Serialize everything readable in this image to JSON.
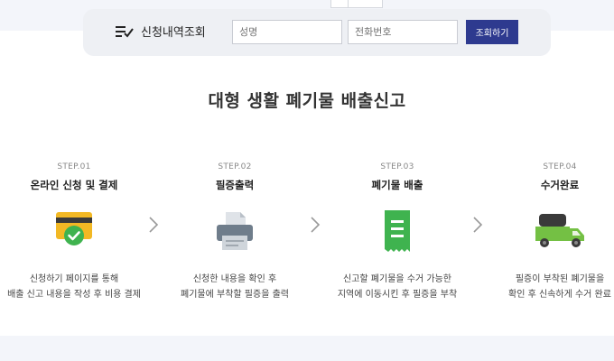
{
  "search": {
    "title": "신청내역조회",
    "name_placeholder": "성명",
    "phone_placeholder": "전화번호",
    "button_label": "조회하기"
  },
  "heading": "대형 생활 폐기물 배출신고",
  "steps": [
    {
      "no": "STEP.01",
      "title": "온라인 신청 및 결제",
      "desc_line1": "신청하기 페이지를 통해",
      "desc_line2": "배출 신고 내용을 작성 후 비용 결제",
      "icon": "card-check-icon"
    },
    {
      "no": "STEP.02",
      "title": "필증출력",
      "desc_line1": "신청한 내용을 확인 후",
      "desc_line2": "폐기물에 부착할 필증을 출력",
      "icon": "printer-icon"
    },
    {
      "no": "STEP.03",
      "title": "폐기물 배출",
      "desc_line1": "신고할 폐기물을 수거 가능한",
      "desc_line2": "지역에 이동시킨 후 필증을 부착",
      "icon": "receipt-icon"
    },
    {
      "no": "STEP.04",
      "title": "수거완료",
      "desc_line1": "필증이 부착된 폐기물을",
      "desc_line2": "확인 후 신속하게 수거 완료",
      "icon": "truck-icon"
    }
  ],
  "colors": {
    "accent": "#2e3a8f",
    "green": "#3fb34f",
    "yellow": "#f2b824",
    "gray": "#6f7d8b"
  }
}
